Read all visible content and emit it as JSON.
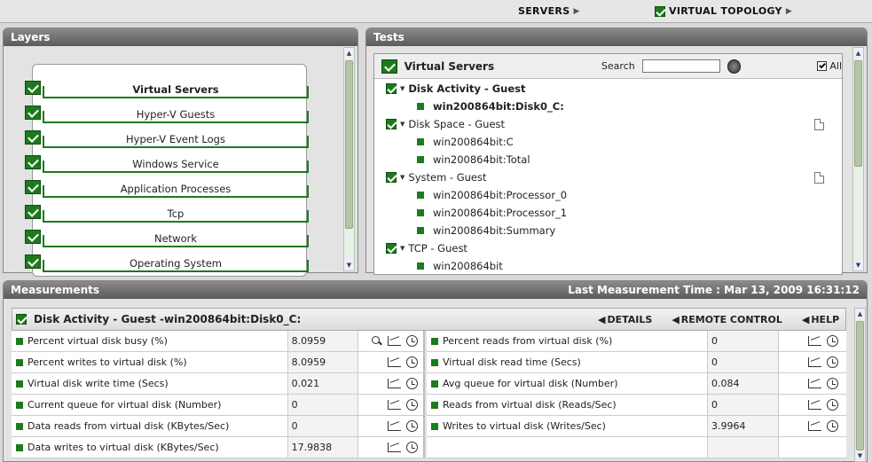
{
  "topnav": {
    "servers": "SERVERS",
    "virtual_topology": "VIRTUAL TOPOLOGY"
  },
  "layers": {
    "title": "Layers",
    "items": [
      {
        "label": "Virtual Servers",
        "bold": true
      },
      {
        "label": "Hyper-V Guests"
      },
      {
        "label": "Hyper-V Event Logs"
      },
      {
        "label": "Windows Service"
      },
      {
        "label": "Application Processes"
      },
      {
        "label": "Tcp"
      },
      {
        "label": "Network"
      },
      {
        "label": "Operating System"
      }
    ]
  },
  "tests": {
    "title": "Tests",
    "header": "Virtual Servers",
    "search_label": "Search",
    "search_value": "",
    "all_label": "All",
    "groups": [
      {
        "name": "Disk Activity - Guest",
        "items": [
          "win200864bit:Disk0_C:"
        ]
      },
      {
        "name": "Disk Space - Guest",
        "items": [
          "win200864bit:C",
          "win200864bit:Total"
        ]
      },
      {
        "name": "System - Guest",
        "items": [
          "win200864bit:Processor_0",
          "win200864bit:Processor_1",
          "win200864bit:Summary"
        ]
      },
      {
        "name": "TCP - Guest",
        "items": [
          "win200864bit"
        ]
      }
    ]
  },
  "measurements": {
    "title": "Measurements",
    "last_time": "Last Measurement Time : Mar 13, 2009 16:31:12",
    "section_title": "Disk Activity - Guest -win200864bit:Disk0_C:",
    "details": "DETAILS",
    "remote_control": "REMOTE CONTROL",
    "help": "HELP",
    "left": [
      {
        "name": "Percent virtual disk busy (%)",
        "value": "8.0959"
      },
      {
        "name": "Percent writes to virtual disk (%)",
        "value": "8.0959"
      },
      {
        "name": "Virtual disk write time (Secs)",
        "value": "0.021"
      },
      {
        "name": "Current queue for virtual disk (Number)",
        "value": "0"
      },
      {
        "name": "Data reads from virtual disk (KBytes/Sec)",
        "value": "0"
      },
      {
        "name": "Data writes to virtual disk (KBytes/Sec)",
        "value": "17.9838"
      }
    ],
    "right": [
      {
        "name": "Percent reads from virtual disk (%)",
        "value": "0"
      },
      {
        "name": "Virtual disk read time (Secs)",
        "value": "0"
      },
      {
        "name": "Avg queue for virtual disk (Number)",
        "value": "0.084"
      },
      {
        "name": "Reads from virtual disk (Reads/Sec)",
        "value": "0"
      },
      {
        "name": "Writes to virtual disk (Writes/Sec)",
        "value": "3.9964"
      }
    ]
  }
}
